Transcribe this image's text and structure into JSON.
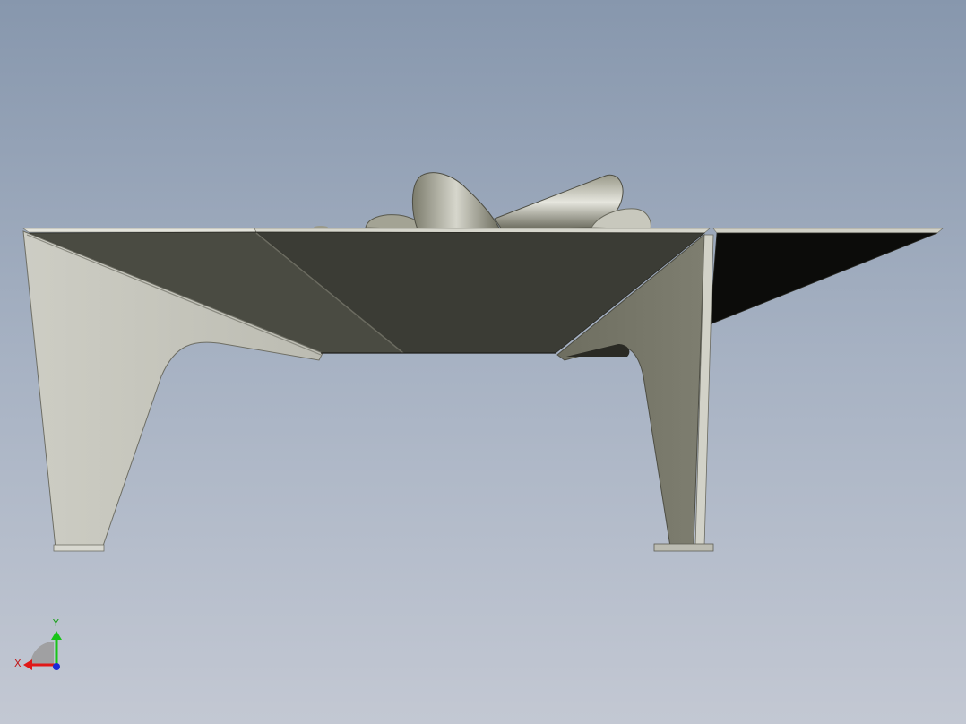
{
  "viewport": {
    "background_top": "#8797ad",
    "background_bottom": "#c3c8d3"
  },
  "model": {
    "description_icon": "fire-pit-3d-model",
    "colors": {
      "panel_light": "#c5c5bc",
      "panel_dark": "#3c3d36",
      "panel_mid": "#727264",
      "panel_black": "#0c0c0a",
      "edge_highlight": "#e8e8e2",
      "log": "#8f8f80"
    }
  },
  "triad": {
    "x_label": "X",
    "y_label": "Y",
    "x_color": "#e01818",
    "y_color": "#18c418",
    "z_color": "#1a2ad8"
  }
}
